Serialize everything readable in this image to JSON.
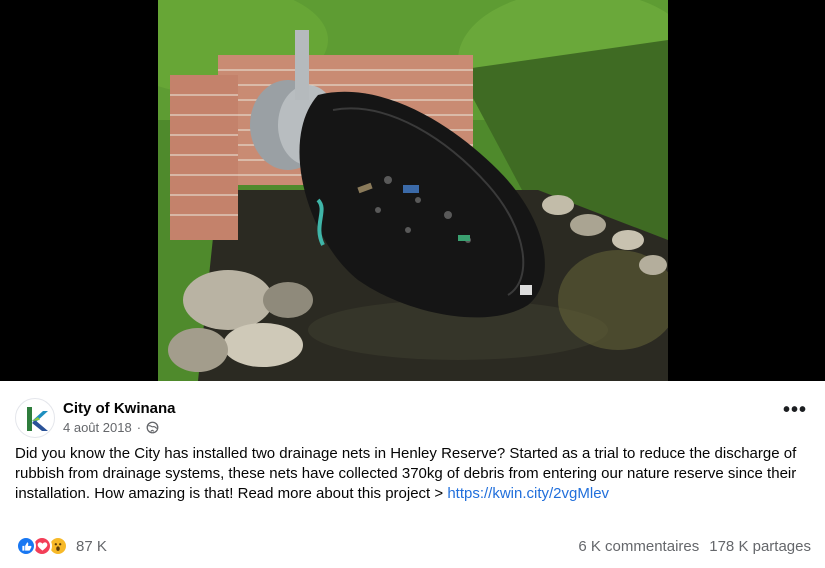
{
  "post": {
    "page_name": "City of Kwinana",
    "date": "4 août 2018",
    "separator": "·",
    "audience_icon": "globe-icon",
    "more_icon": "more-options-icon",
    "more_label": "•••",
    "text": "Did you know the City has installed two drainage nets in Henley Reserve? Started as a trial to reduce the discharge of rubbish from drainage systems, these nets have collected 370kg of debris from entering our nature reserve since their installation. How amazing is that! Read more about this project > ",
    "link": "https://kwin.city/2vgMlev"
  },
  "media": {
    "icon": "photo-drainage-net"
  },
  "footer": {
    "reaction_icons": [
      "like-icon",
      "love-icon",
      "wow-icon"
    ],
    "reaction_count": "87 K",
    "comments": "6 K commentaires",
    "shares": "178 K partages"
  },
  "colors": {
    "link": "#216fdb",
    "like": "#1877f2",
    "love": "#f33e58",
    "wow": "#f7b928",
    "muted_text": "#65676b"
  }
}
